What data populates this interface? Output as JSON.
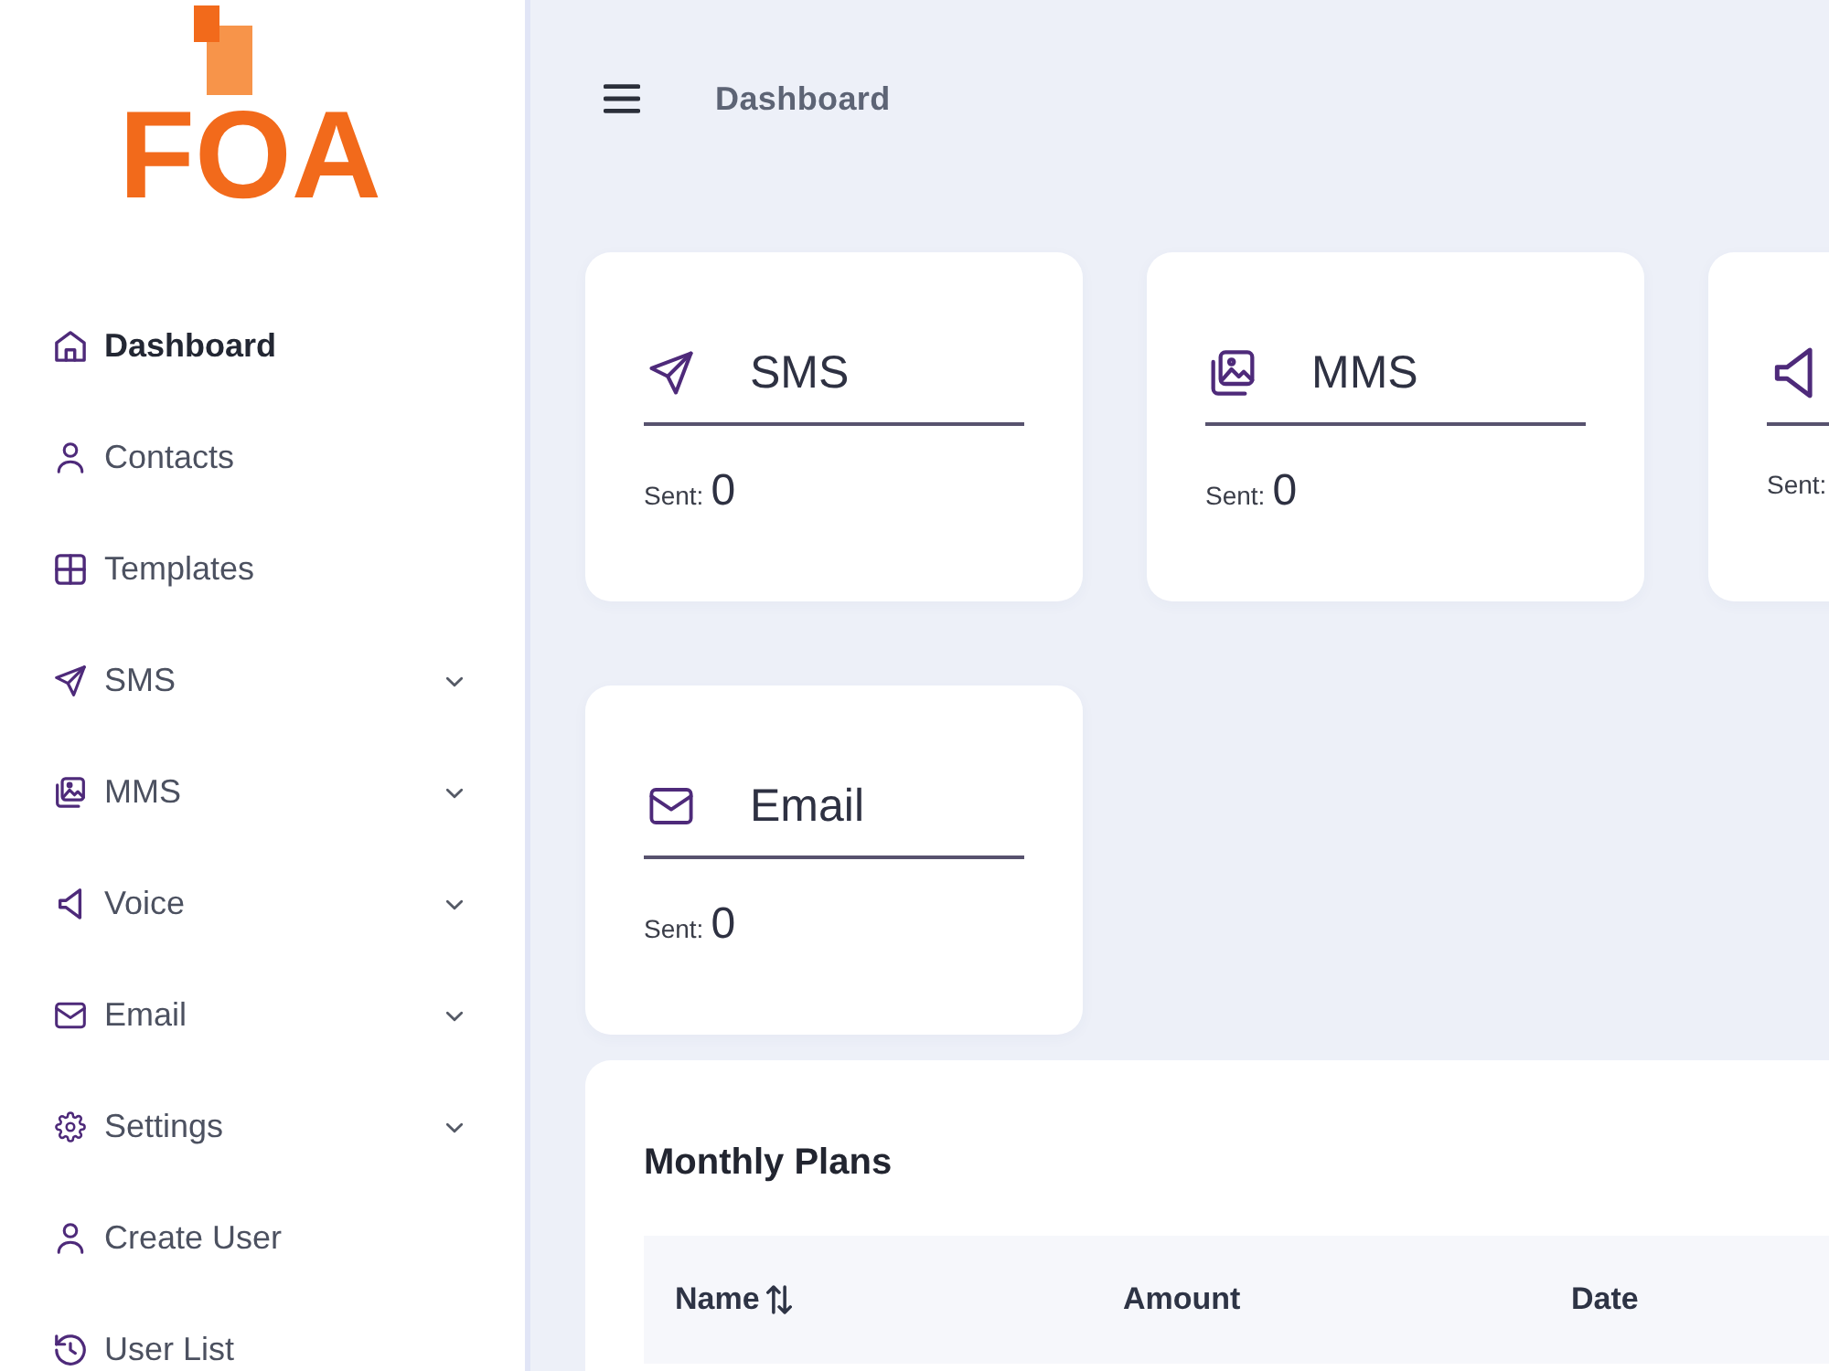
{
  "logo": {
    "text": "FOA"
  },
  "sidebar": {
    "items": [
      {
        "label": "Dashboard",
        "selected": true,
        "submenu": false
      },
      {
        "label": "Contacts",
        "selected": false,
        "submenu": false
      },
      {
        "label": "Templates",
        "selected": false,
        "submenu": false
      },
      {
        "label": "SMS",
        "selected": false,
        "submenu": true
      },
      {
        "label": "MMS",
        "selected": false,
        "submenu": true
      },
      {
        "label": "Voice",
        "selected": false,
        "submenu": true
      },
      {
        "label": "Email",
        "selected": false,
        "submenu": true
      },
      {
        "label": "Settings",
        "selected": false,
        "submenu": true
      },
      {
        "label": "Create User",
        "selected": false,
        "submenu": false
      },
      {
        "label": "User List",
        "selected": false,
        "submenu": false
      }
    ]
  },
  "header": {
    "title": "Dashboard"
  },
  "cards": [
    {
      "title": "SMS",
      "sent_label": "Sent:",
      "count": "0"
    },
    {
      "title": "MMS",
      "sent_label": "Sent:",
      "count": "0"
    },
    {
      "sent_label": "Sent:"
    },
    {
      "title": "Email",
      "sent_label": "Sent:",
      "count": "0"
    }
  ],
  "monthly_plans": {
    "title": "Monthly Plans",
    "table": {
      "columns": [
        {
          "label": "Name",
          "sortable": true
        },
        {
          "label": "Amount",
          "sortable": false
        },
        {
          "label": "Date",
          "sortable": false
        }
      ]
    }
  }
}
